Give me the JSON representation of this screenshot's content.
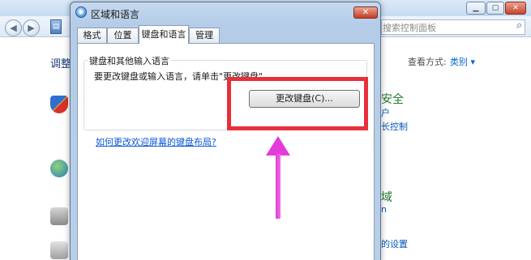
{
  "background_window": {
    "search_placeholder": "搜索控制面板",
    "left_title": "调整",
    "view_by_label": "查看方式:",
    "view_by_value": "类别 ▾",
    "group1_title": "安全",
    "group1_link1": "户",
    "group1_link2": "长控制",
    "group2_title": "域",
    "group2_link1": "n",
    "group2_link2": "的设置"
  },
  "dialog": {
    "title": "区域和语言",
    "close_label": "✕",
    "tabs": [
      {
        "label": "格式"
      },
      {
        "label": "位置"
      },
      {
        "label": "键盘和语言"
      },
      {
        "label": "管理"
      }
    ],
    "active_tab": "键盘和语言",
    "group_label": "键盘和其他输入语言",
    "group_description": "要更改键盘或输入语言，请单击\"更改键盘\"。",
    "change_keyboard_button": "更改键盘(C)...",
    "help_link": "如何更改欢迎屏幕的键盘布局?"
  },
  "annotation": {
    "highlight_color": "#e8303a",
    "arrow_color": "#e33bd9"
  },
  "icons": [
    "back-icon",
    "forward-icon",
    "search-icon",
    "globe-icon",
    "close-icon"
  ]
}
